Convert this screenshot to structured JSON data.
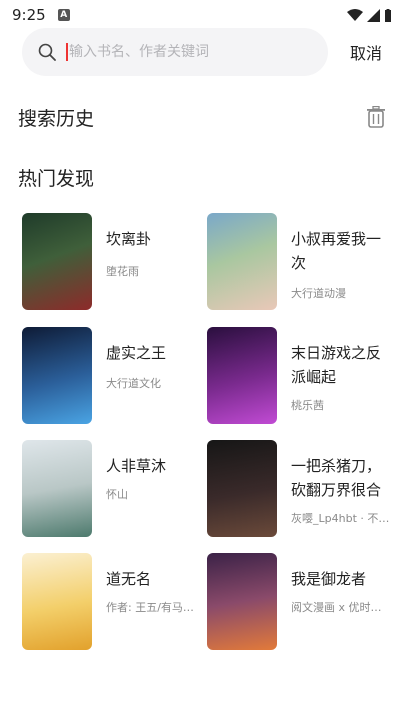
{
  "status": {
    "time": "9:25",
    "indicator": "A"
  },
  "search": {
    "placeholder": "输入书名、作者关键词",
    "cancel": "取消"
  },
  "sections": {
    "history": "搜索历史",
    "hot": "热门发现"
  },
  "books": [
    {
      "title": "坎离卦",
      "author": "堕花雨",
      "cover_colors": [
        "#1f3b2a",
        "#8e2a2a"
      ]
    },
    {
      "title": "小叔再爱我一次",
      "author": "大行道动漫",
      "cover_colors": [
        "#7aa8c9",
        "#e9c8b8"
      ]
    },
    {
      "title": "虚实之王",
      "author": "大行道文化",
      "cover_colors": [
        "#0e1b36",
        "#4aa4e4"
      ]
    },
    {
      "title": "末日游戏之反派崛起",
      "author": "桃乐茜",
      "cover_colors": [
        "#2a0f3e",
        "#c14bd4"
      ]
    },
    {
      "title": "人非草沐",
      "author": "怀山",
      "cover_colors": [
        "#dfe6ea",
        "#4d7a6d"
      ]
    },
    {
      "title": "一把杀猪刀，砍翻万界很合",
      "author": "灰嘤_Lp4hbt · 不…",
      "cover_colors": [
        "#161616",
        "#6b4a3a"
      ]
    },
    {
      "title": "道无名",
      "author": "作者: 王五/有马…",
      "cover_colors": [
        "#fbf0d2",
        "#e2a12c"
      ]
    },
    {
      "title": "我是御龙者",
      "author": "阅文漫画 x 优时…",
      "cover_colors": [
        "#3b2247",
        "#e27a3a"
      ]
    }
  ]
}
